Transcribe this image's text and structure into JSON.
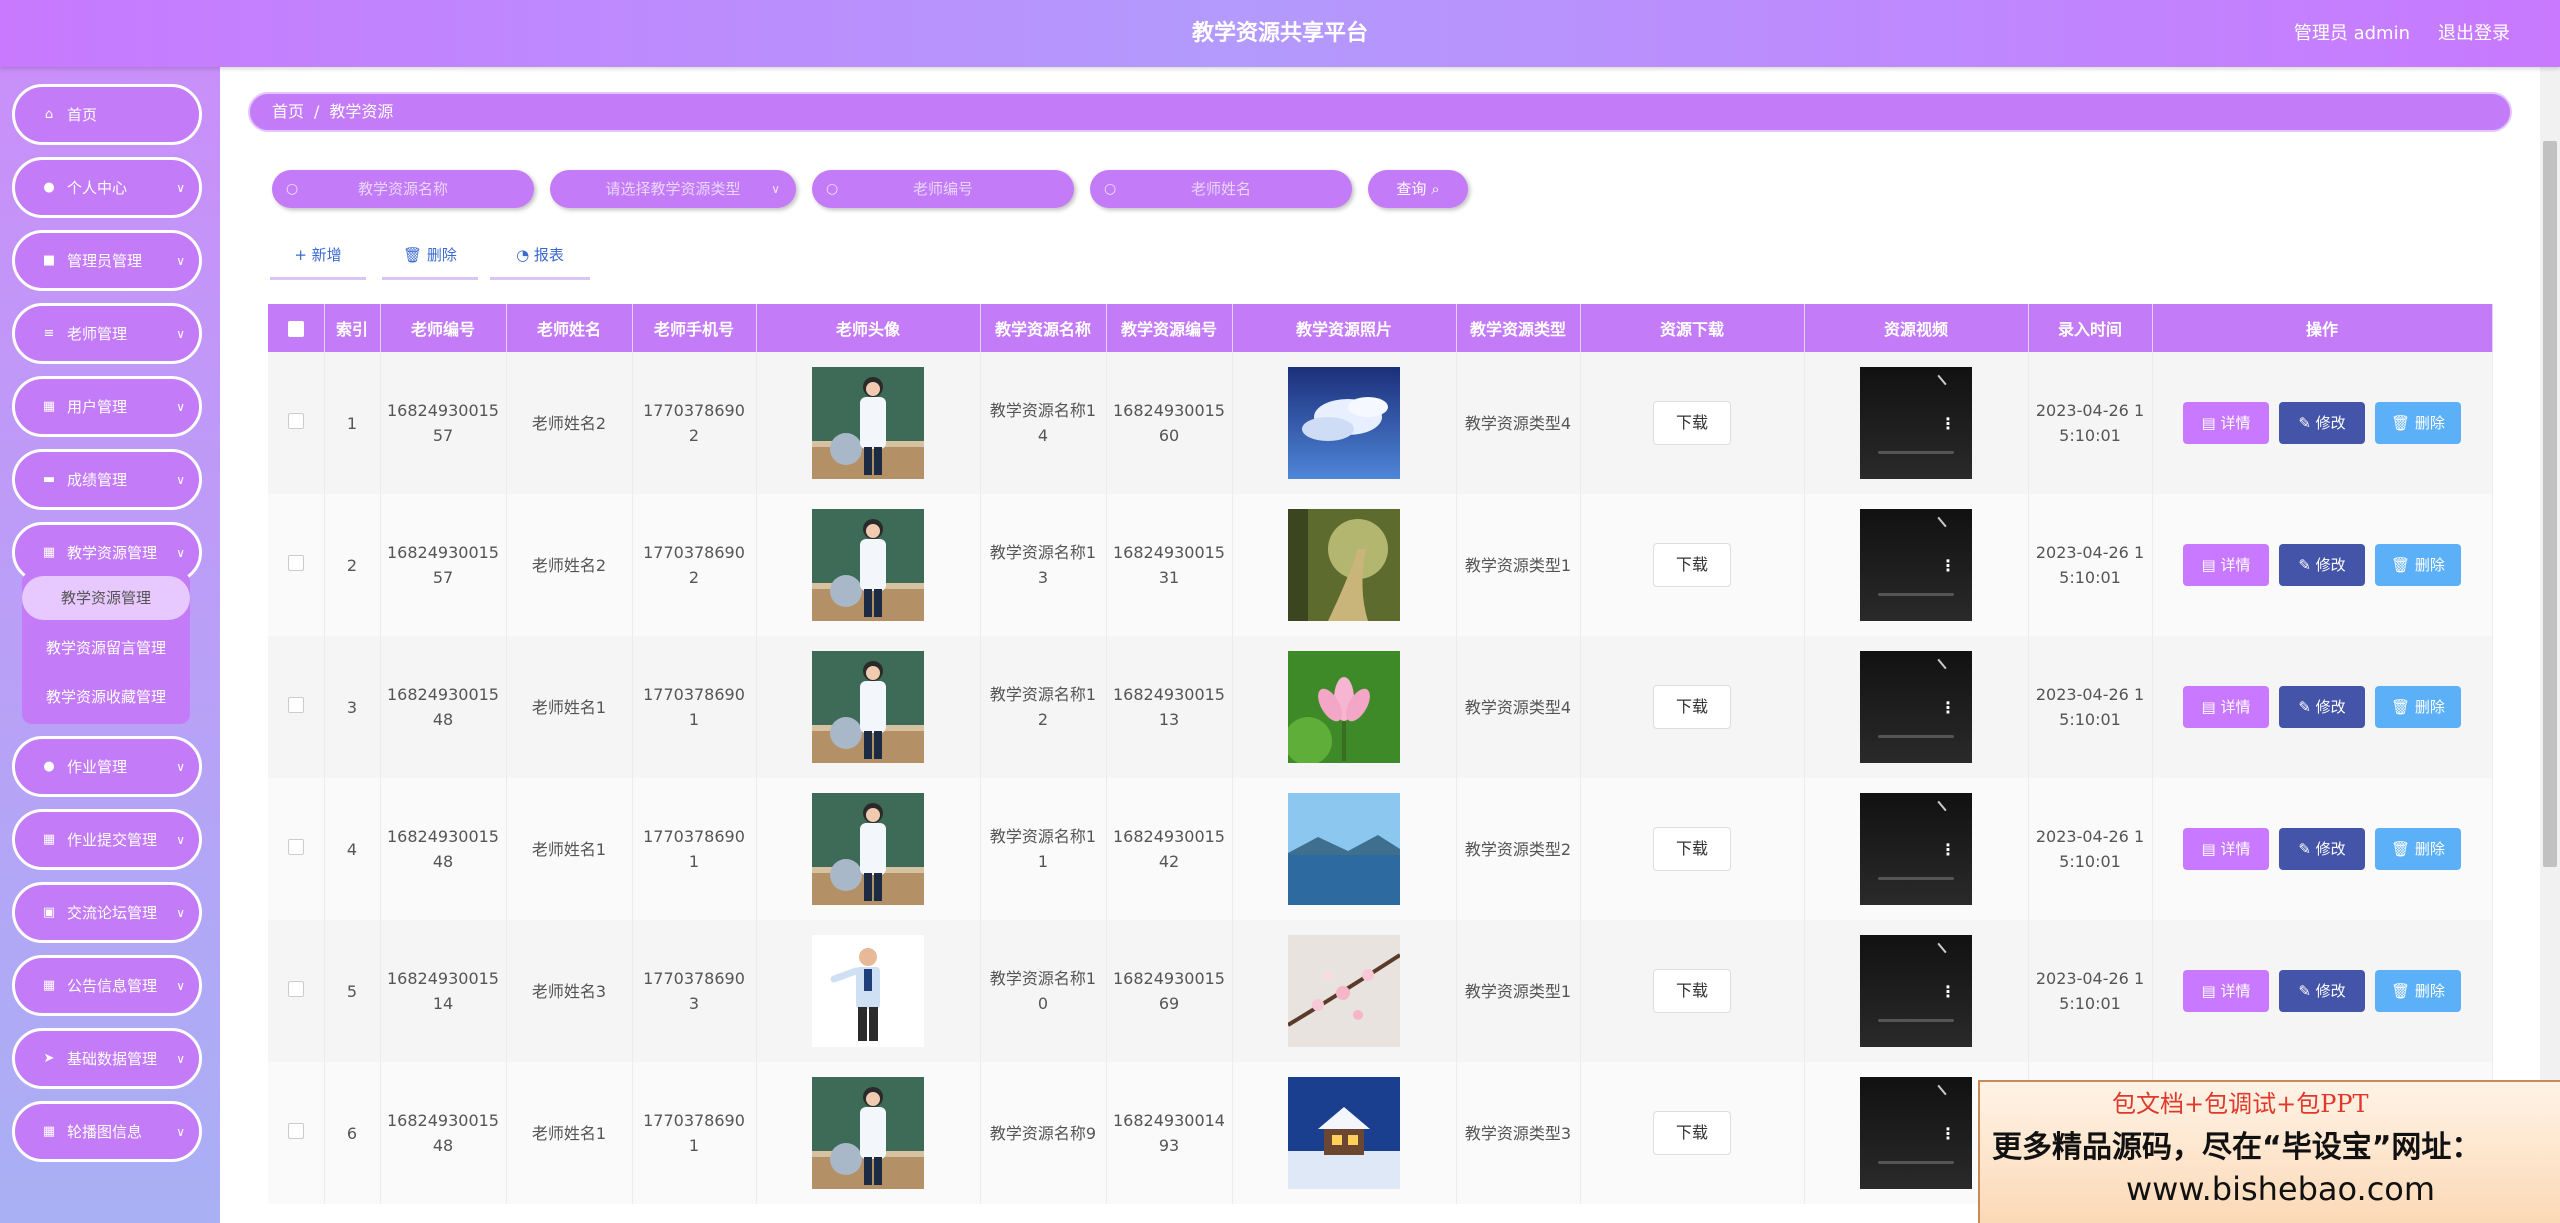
{
  "header": {
    "title": "教学资源共享平台",
    "user": "管理员 admin",
    "logout": "退出登录"
  },
  "sidebar": {
    "items": [
      {
        "label": "首页",
        "icon": "home-icon"
      },
      {
        "label": "个人中心",
        "icon": "user-icon"
      },
      {
        "label": "管理员管理",
        "icon": "briefcase-icon"
      },
      {
        "label": "老师管理",
        "icon": "list-icon"
      },
      {
        "label": "用户管理",
        "icon": "grid-icon"
      },
      {
        "label": "成绩管理",
        "icon": "monitor-icon"
      },
      {
        "label": "教学资源管理",
        "icon": "grid-icon"
      },
      {
        "label": "作业管理",
        "icon": "user-icon"
      },
      {
        "label": "作业提交管理",
        "icon": "grid-icon"
      },
      {
        "label": "交流论坛管理",
        "icon": "clipboard-icon"
      },
      {
        "label": "公告信息管理",
        "icon": "grid-icon"
      },
      {
        "label": "基础数据管理",
        "icon": "send-icon"
      },
      {
        "label": "轮播图信息",
        "icon": "grid-icon"
      }
    ],
    "submenu": [
      "教学资源管理",
      "教学资源留言管理",
      "教学资源收藏管理"
    ]
  },
  "breadcrumb": {
    "home": "首页",
    "sep": "/",
    "current": "教学资源"
  },
  "search": {
    "name_placeholder": "教学资源名称",
    "type_placeholder": "请选择教学资源类型",
    "teacher_no_placeholder": "老师编号",
    "teacher_name_placeholder": "老师姓名",
    "query_label": "查询"
  },
  "toolbar": {
    "add_label": "新增",
    "delete_label": "删除",
    "report_label": "报表"
  },
  "table": {
    "headers": [
      "索引",
      "老师编号",
      "老师姓名",
      "老师手机号",
      "老师头像",
      "教学资源名称",
      "教学资源编号",
      "教学资源照片",
      "教学资源类型",
      "资源下载",
      "资源视频",
      "录入时间",
      "操作"
    ],
    "download_label": "下载",
    "detail_label": "详情",
    "edit_label": "修改",
    "delete_label": "删除",
    "rows": [
      {
        "index": "1",
        "teacher_no": "1682493001557",
        "teacher_name": "老师姓名2",
        "phone": "17703786902",
        "res_name": "教学资源名称14",
        "res_no": "1682493001560",
        "res_type": "教学资源类型4",
        "time": "2023-04-26 15:10:01",
        "avatar": "teacher-female",
        "photo": "sky-clouds"
      },
      {
        "index": "2",
        "teacher_no": "1682493001557",
        "teacher_name": "老师姓名2",
        "phone": "17703786902",
        "res_name": "教学资源名称13",
        "res_no": "1682493001531",
        "res_type": "教学资源类型1",
        "time": "2023-04-26 15:10:01",
        "avatar": "teacher-female",
        "photo": "forest-path"
      },
      {
        "index": "3",
        "teacher_no": "1682493001548",
        "teacher_name": "老师姓名1",
        "phone": "17703786901",
        "res_name": "教学资源名称12",
        "res_no": "1682493001513",
        "res_type": "教学资源类型4",
        "time": "2023-04-26 15:10:01",
        "avatar": "teacher-female",
        "photo": "lotus"
      },
      {
        "index": "4",
        "teacher_no": "1682493001548",
        "teacher_name": "老师姓名1",
        "phone": "17703786901",
        "res_name": "教学资源名称11",
        "res_no": "1682493001542",
        "res_type": "教学资源类型2",
        "time": "2023-04-26 15:10:01",
        "avatar": "teacher-female",
        "photo": "lake"
      },
      {
        "index": "5",
        "teacher_no": "1682493001514",
        "teacher_name": "老师姓名3",
        "phone": "17703786903",
        "res_name": "教学资源名称10",
        "res_no": "1682493001569",
        "res_type": "教学资源类型1",
        "time": "2023-04-26 15:10:01",
        "avatar": "teacher-male",
        "photo": "blossom"
      },
      {
        "index": "6",
        "teacher_no": "1682493001548",
        "teacher_name": "老师姓名1",
        "phone": "17703786901",
        "res_name": "教学资源名称9",
        "res_no": "1682493001493",
        "res_type": "教学资源类型3",
        "time": "",
        "avatar": "teacher-female",
        "photo": "snow-cabin"
      }
    ]
  },
  "ad": {
    "line1": "包文档+包调试+包PPT",
    "line2": "更多精品源码，尽在“毕设宝”网址：",
    "line3": "www.bishebao.com"
  },
  "colors": {
    "primary": "#c37bf8",
    "edit": "#4454a8",
    "delete": "#5cb0f7"
  }
}
